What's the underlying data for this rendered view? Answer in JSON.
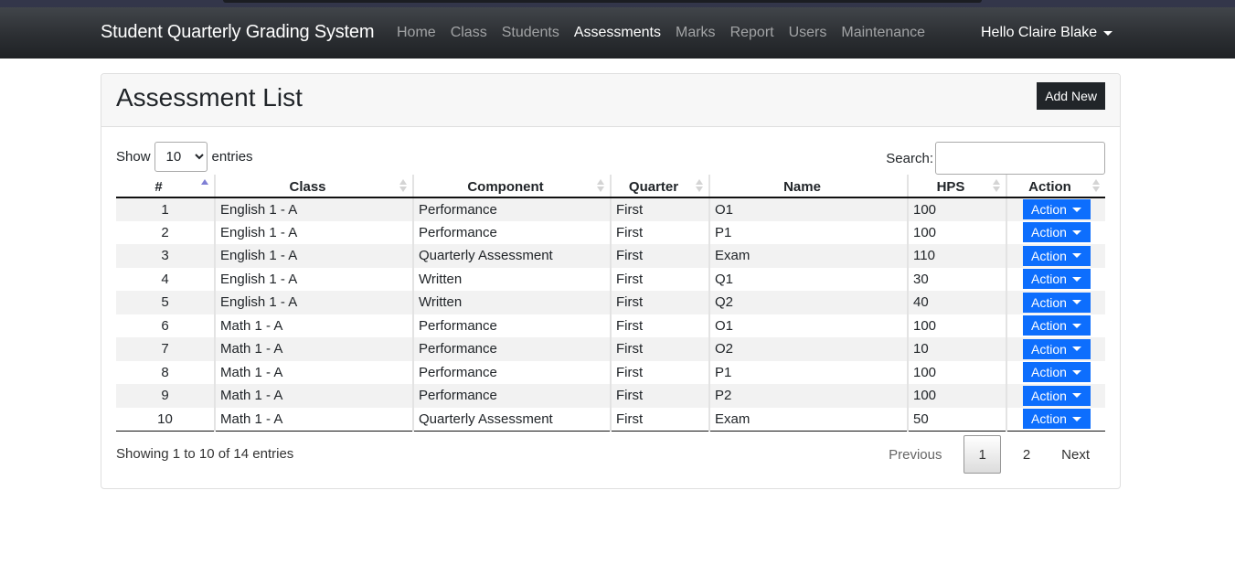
{
  "navbar": {
    "brand": "Student Quarterly Grading System",
    "links": [
      {
        "label": "Home",
        "active": false
      },
      {
        "label": "Class",
        "active": false
      },
      {
        "label": "Students",
        "active": false
      },
      {
        "label": "Assessments",
        "active": true
      },
      {
        "label": "Marks",
        "active": false
      },
      {
        "label": "Report",
        "active": false
      },
      {
        "label": "Users",
        "active": false
      },
      {
        "label": "Maintenance",
        "active": false
      }
    ],
    "user_greeting": "Hello Claire Blake"
  },
  "page": {
    "title": "Assessment List",
    "add_new_label": "Add New"
  },
  "table_controls": {
    "show_label": "Show",
    "entries_label": "entries",
    "page_length": "10",
    "search_label": "Search:",
    "search_value": "",
    "search_placeholder": ""
  },
  "table": {
    "columns": [
      "#",
      "Class",
      "Component",
      "Quarter",
      "Name",
      "HPS",
      "Action"
    ],
    "sorted_column": "#",
    "sort_direction": "asc",
    "action_label": "Action",
    "rows": [
      {
        "num": "1",
        "class": "English 1 - A",
        "component": "Performance",
        "quarter": "First",
        "name": "O1",
        "hps": "100"
      },
      {
        "num": "2",
        "class": "English 1 - A",
        "component": "Performance",
        "quarter": "First",
        "name": "P1",
        "hps": "100"
      },
      {
        "num": "3",
        "class": "English 1 - A",
        "component": "Quarterly Assessment",
        "quarter": "First",
        "name": "Exam",
        "hps": "110"
      },
      {
        "num": "4",
        "class": "English 1 - A",
        "component": "Written",
        "quarter": "First",
        "name": "Q1",
        "hps": "30"
      },
      {
        "num": "5",
        "class": "English 1 - A",
        "component": "Written",
        "quarter": "First",
        "name": "Q2",
        "hps": "40"
      },
      {
        "num": "6",
        "class": "Math 1 - A",
        "component": "Performance",
        "quarter": "First",
        "name": "O1",
        "hps": "100"
      },
      {
        "num": "7",
        "class": "Math 1 - A",
        "component": "Performance",
        "quarter": "First",
        "name": "O2",
        "hps": "10"
      },
      {
        "num": "8",
        "class": "Math 1 - A",
        "component": "Performance",
        "quarter": "First",
        "name": "P1",
        "hps": "100"
      },
      {
        "num": "9",
        "class": "Math 1 - A",
        "component": "Performance",
        "quarter": "First",
        "name": "P2",
        "hps": "100"
      },
      {
        "num": "10",
        "class": "Math 1 - A",
        "component": "Quarterly Assessment",
        "quarter": "First",
        "name": "Exam",
        "hps": "50"
      }
    ]
  },
  "footer": {
    "info": "Showing 1 to 10 of 14 entries",
    "pagination": {
      "previous": "Previous",
      "pages": [
        "1",
        "2"
      ],
      "current_page": "1",
      "next": "Next"
    }
  },
  "colors": {
    "navbar_bg": "#2c2f33",
    "primary": "#0d6efd",
    "dark_button": "#212529",
    "sort_active": "#7f7fd5"
  }
}
